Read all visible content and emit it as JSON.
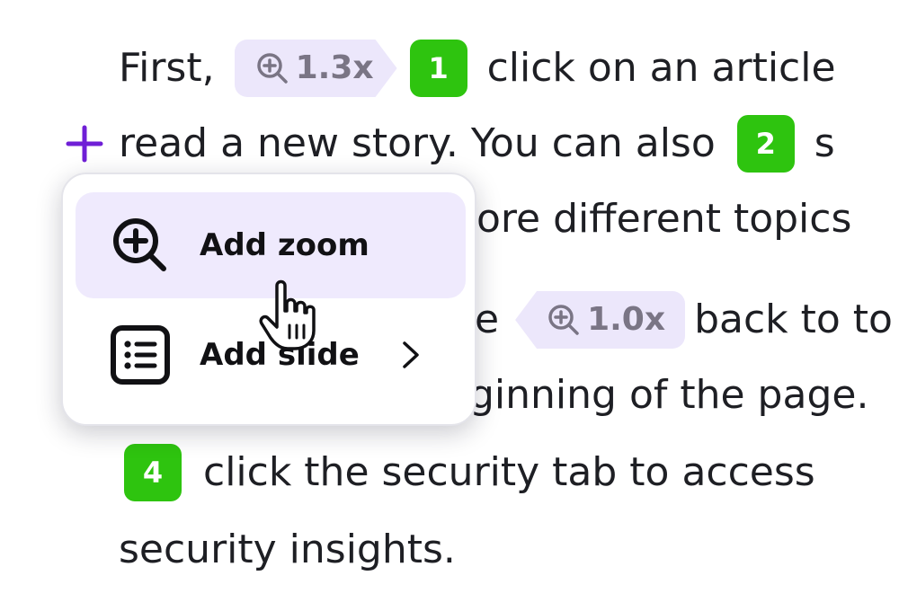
{
  "text": {
    "line1_before": "First,",
    "line1_after": "click on an article",
    "line2": "read a new story. You can also",
    "line2_tail": "s",
    "line3": "ore different topics",
    "line4_before": "e",
    "line4_after": "back to to",
    "line5": "ginning of the page.",
    "line6": "click the security tab to access",
    "line7": "security insights."
  },
  "zoom_chips": [
    {
      "label": "1.3x",
      "direction": "right"
    },
    {
      "label": "1.0x",
      "direction": "left"
    }
  ],
  "step_badges": [
    "1",
    "2",
    "4"
  ],
  "context_menu": {
    "items": [
      {
        "label": "Add zoom",
        "icon": "zoom-in-icon",
        "active": true
      },
      {
        "label": "Add slide",
        "icon": "list-icon",
        "has_submenu": true
      }
    ]
  },
  "colors": {
    "accent_purple": "#6f1fd6",
    "chip_bg": "#ece7fb",
    "badge_green": "#2ec40f",
    "menu_active_bg": "#efeafd",
    "text": "#1e1f24"
  }
}
